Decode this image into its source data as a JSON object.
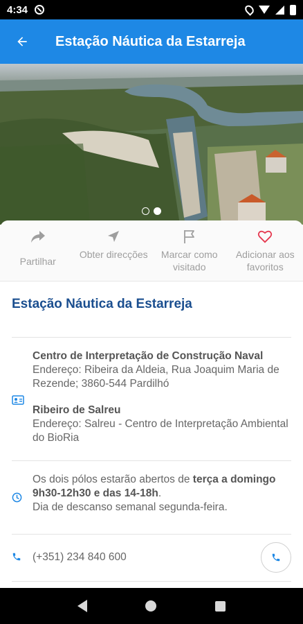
{
  "status_bar": {
    "time": "4:34"
  },
  "app_bar": {
    "title": "Estação Náutica da Estarreja"
  },
  "actions": [
    {
      "icon": "share-icon",
      "label": "Partilhar"
    },
    {
      "icon": "navigation-arrow-icon",
      "label": "Obter direcções"
    },
    {
      "icon": "flag-icon",
      "label": "Marcar como visitado"
    },
    {
      "icon": "heart-icon",
      "label": "Adicionar aos favoritos"
    }
  ],
  "place": {
    "title": "Estação Náutica da Estarreja",
    "locations": [
      {
        "name": "Centro de Interpretação de Construção Naval",
        "address": "Endereço: Ribeira da Aldeia, Rua Joaquim Maria de Rezende; 3860-544 Pardilhó"
      },
      {
        "name": "Ribeiro de Salreu",
        "address": "Endereço: Salreu - Centro de Interpretação Ambiental do BioRia"
      }
    ],
    "hours": {
      "prefix": "Os dois pólos estarão abertos de ",
      "bold": "terça a domingo 9h30-12h30 e das 14-18h",
      "suffix": ".",
      "rest_day": "Dia de descanso semanal segunda-feira."
    },
    "phone": "(+351) 234 840 600"
  },
  "gallery": {
    "image_count": 2,
    "active_index": 1
  },
  "colors": {
    "primary": "#1e88e5",
    "title_blue": "#1a4e8f",
    "heart": "#e53950"
  }
}
